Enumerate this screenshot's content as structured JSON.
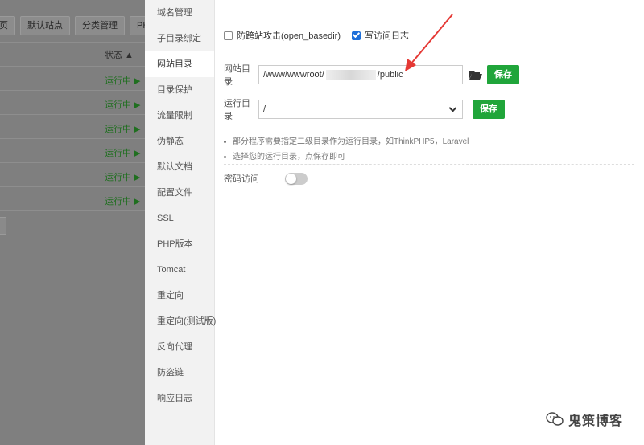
{
  "background": {
    "toolbar": [
      "页",
      "默认站点",
      "分类管理",
      "PHP命令"
    ],
    "status_header": "状态 ▲",
    "status_rows": [
      "运行中 ▶",
      "运行中 ▶",
      "运行中 ▶",
      "运行中 ▶",
      "运行中 ▶",
      "运行中 ▶"
    ]
  },
  "sidebar": {
    "items": [
      {
        "label": "域名管理"
      },
      {
        "label": "子目录绑定"
      },
      {
        "label": "网站目录"
      },
      {
        "label": "目录保护"
      },
      {
        "label": "流量限制"
      },
      {
        "label": "伪静态"
      },
      {
        "label": "默认文档"
      },
      {
        "label": "配置文件"
      },
      {
        "label": "SSL"
      },
      {
        "label": "PHP版本"
      },
      {
        "label": "Tomcat"
      },
      {
        "label": "重定向"
      },
      {
        "label": "重定向(测试版)"
      },
      {
        "label": "反向代理"
      },
      {
        "label": "防盗链"
      },
      {
        "label": "响应日志"
      }
    ],
    "active_index": 2
  },
  "options": {
    "cross_site": {
      "label": "防跨站攻击(open_basedir)",
      "checked": false
    },
    "access_log": {
      "label": "写访问日志",
      "checked": true
    }
  },
  "site_dir": {
    "label": "网站目录",
    "value_prefix": "/www/wwwroot/",
    "value_suffix": "/public",
    "save_label": "保存",
    "folder_icon": "folder-open-icon"
  },
  "run_dir": {
    "label": "运行目录",
    "selected": "/",
    "save_label": "保存"
  },
  "tips": [
    "部分程序需要指定二级目录作为运行目录，如ThinkPHP5，Laravel",
    "选择您的运行目录，点保存即可"
  ],
  "password_access": {
    "label": "密码访问",
    "enabled": false
  },
  "watermark": {
    "text": "鬼策博客"
  },
  "colors": {
    "save_button": "#20a53a",
    "checkbox_checked": "#1e6fd9",
    "arrow": "#e53935"
  }
}
